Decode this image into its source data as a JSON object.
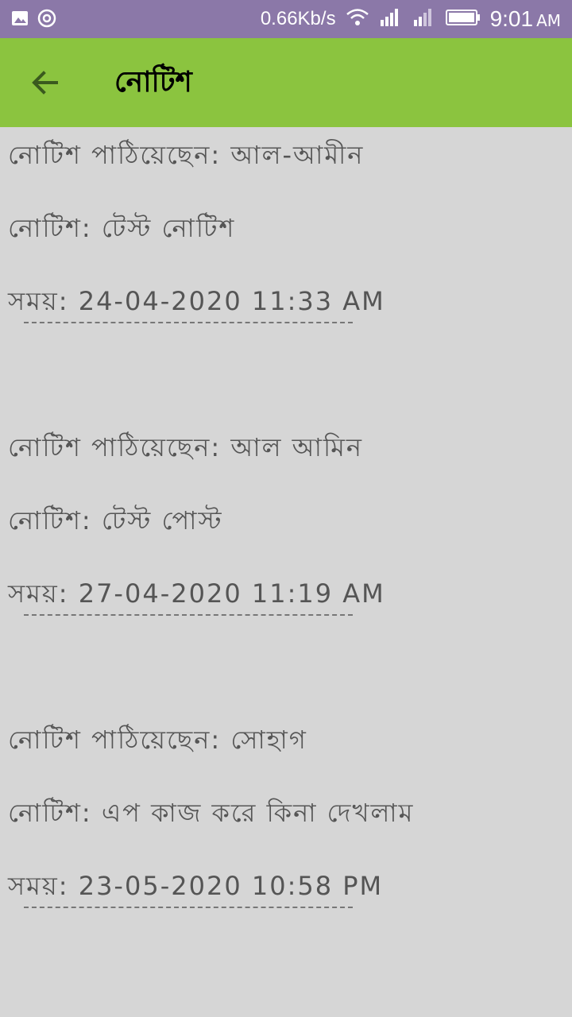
{
  "status_bar": {
    "speed": "0.66Kb/s",
    "time": "9:01",
    "ampm": "AM",
    "icons": [
      "image-icon",
      "sync-icon",
      "wifi-icon",
      "signal-icon",
      "signal-icon",
      "battery-icon"
    ]
  },
  "app_bar": {
    "title": "নোটিশ",
    "back_icon": "arrow-left-icon",
    "color": "#8bc43f"
  },
  "notices": [
    {
      "sender": "নোটিশ পাঠিয়েছেন: আল-আমীন",
      "message": "নোটিশ: টেস্ট নোটিশ",
      "time": "সময়: 24-04-2020 11:33 AM"
    },
    {
      "sender": "নোটিশ পাঠিয়েছেন: আল আমিন",
      "message": "নোটিশ: টেস্ট পোস্ট",
      "time": "সময়: 27-04-2020 11:19 AM"
    },
    {
      "sender": "নোটিশ পাঠিয়েছেন: সোহাগ",
      "message": "নোটিশ: এপ কাজ করে কিনা দেখলাম",
      "time": "সময়: 23-05-2020 10:58 PM"
    }
  ]
}
